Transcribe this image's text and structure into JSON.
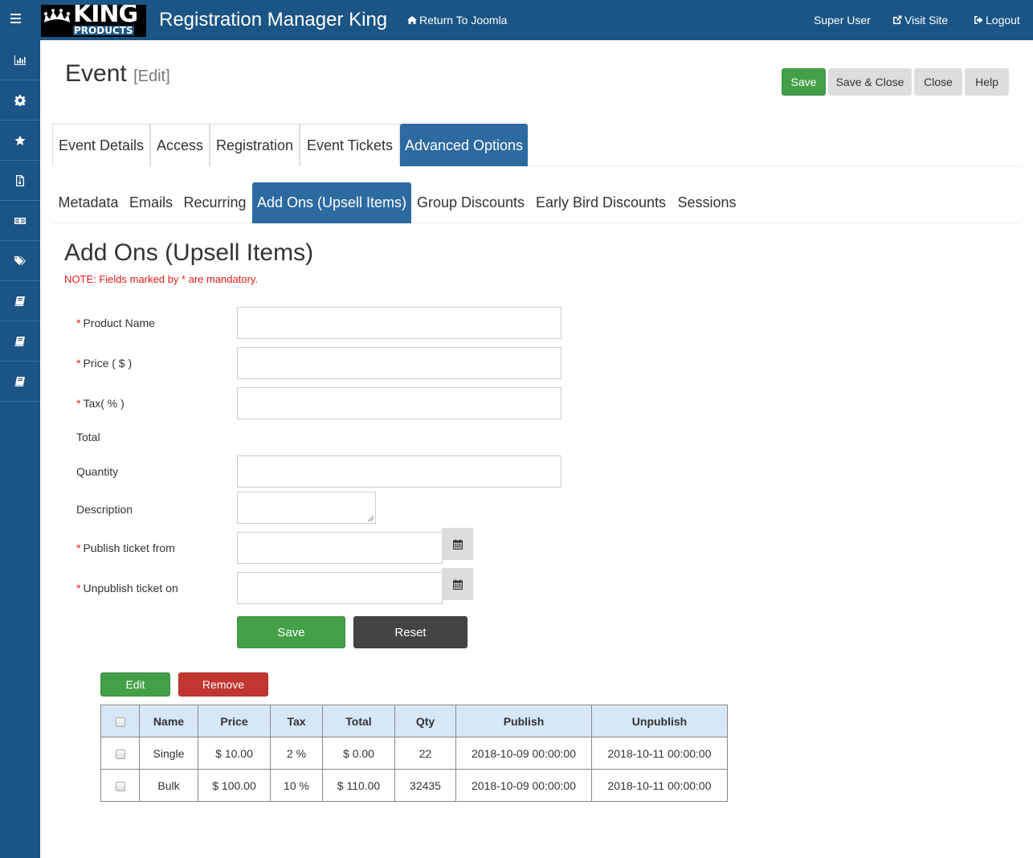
{
  "topbar": {
    "logo_main": "KING",
    "logo_sub": "PRODUCTS",
    "app_title": "Registration Manager King",
    "return_link": "Return To Joomla",
    "user": "Super User",
    "visit_site": "Visit Site",
    "logout": "Logout",
    "background": "#1a5585"
  },
  "sidebar": {
    "items": [
      {
        "icon": "bar-chart-icon"
      },
      {
        "icon": "gear-icon"
      },
      {
        "icon": "star-icon"
      },
      {
        "icon": "file-zip-icon"
      },
      {
        "icon": "money-icon"
      },
      {
        "icon": "tags-icon"
      },
      {
        "icon": "book-icon"
      },
      {
        "icon": "book-icon"
      },
      {
        "icon": "book-icon"
      }
    ]
  },
  "header": {
    "title": "Event",
    "subtitle": "[Edit]",
    "buttons": {
      "save": "Save",
      "save_close": "Save & Close",
      "close": "Close",
      "help": "Help"
    }
  },
  "tabs": [
    {
      "label": "Event Details",
      "active": false
    },
    {
      "label": "Access",
      "active": false
    },
    {
      "label": "Registration",
      "active": false
    },
    {
      "label": "Event Tickets",
      "active": false
    },
    {
      "label": "Advanced Options",
      "active": true
    }
  ],
  "subtabs": [
    {
      "label": "Metadata",
      "active": false
    },
    {
      "label": "Emails",
      "active": false
    },
    {
      "label": "Recurring",
      "active": false
    },
    {
      "label": "Add Ons (Upsell Items)",
      "active": true
    },
    {
      "label": "Group Discounts",
      "active": false
    },
    {
      "label": "Early Bird Discounts",
      "active": false
    },
    {
      "label": "Sessions",
      "active": false
    }
  ],
  "form": {
    "title": "Add Ons (Upsell Items)",
    "note": "NOTE: Fields marked by * are mandatory.",
    "required_mark": "*",
    "fields": {
      "product_name": {
        "label": "Product Name",
        "value": ""
      },
      "price": {
        "label": "Price ( $ )",
        "value": ""
      },
      "tax": {
        "label": "Tax( % )",
        "value": ""
      },
      "total": {
        "label": "Total"
      },
      "quantity": {
        "label": "Quantity",
        "value": ""
      },
      "description": {
        "label": "Description",
        "value": ""
      },
      "publish_from": {
        "label": "Publish ticket from",
        "value": ""
      },
      "unpublish_on": {
        "label": "Unpublish ticket on",
        "value": ""
      }
    },
    "save": "Save",
    "reset": "Reset"
  },
  "list": {
    "edit": "Edit",
    "remove": "Remove",
    "columns": [
      "Name",
      "Price",
      "Tax",
      "Total",
      "Qty",
      "Publish",
      "Unpublish"
    ],
    "rows": [
      {
        "name": "Single",
        "price": "$ 10.00",
        "tax": "2 %",
        "total": "$ 0.00",
        "qty": "22",
        "publish": "2018-10-09 00:00:00",
        "unpublish": "2018-10-11 00:00:00"
      },
      {
        "name": "Bulk",
        "price": "$ 100.00",
        "tax": "10 %",
        "total": "$ 110.00",
        "qty": "32435",
        "publish": "2018-10-09 00:00:00",
        "unpublish": "2018-10-11 00:00:00"
      }
    ]
  },
  "colors": {
    "primary": "#2c6aa0",
    "success": "#43a047",
    "danger": "#c1362f",
    "dark": "#444444",
    "required": "#e41b1b",
    "table_header": "#d6e8f8"
  }
}
